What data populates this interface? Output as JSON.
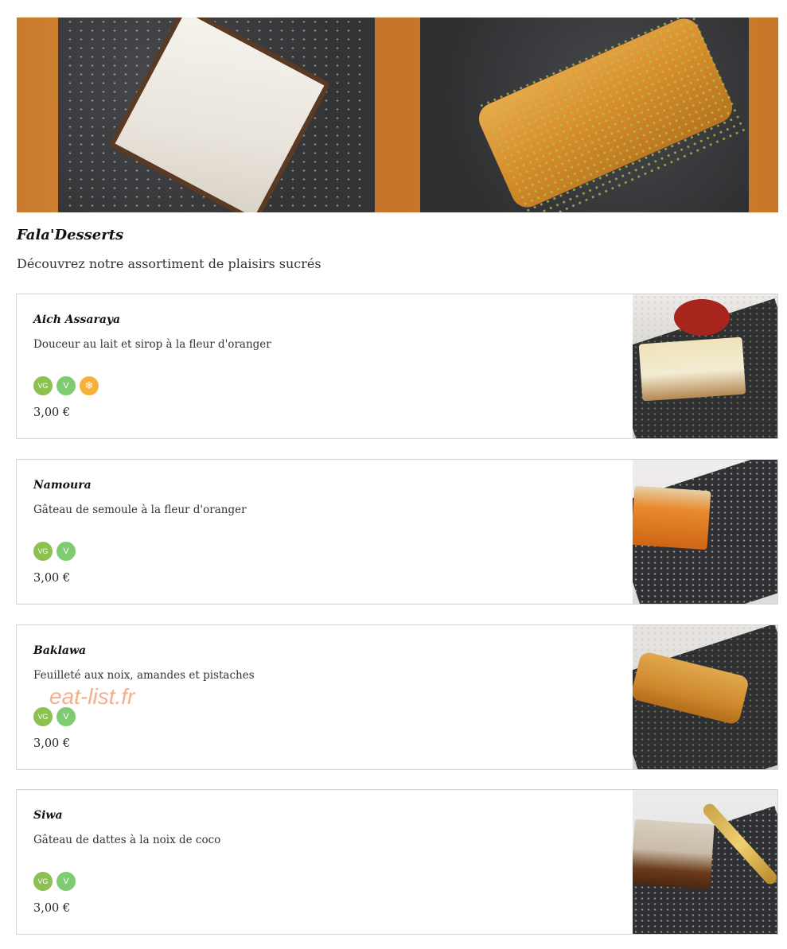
{
  "section": {
    "title": "Fala'Desserts",
    "subtitle": "Découvrez notre assortiment de plaisirs sucrés"
  },
  "items": [
    {
      "name": "Aich Assaraya",
      "description": "Douceur au lait et sirop à la fleur d'oranger",
      "badges": [
        "VG",
        "V",
        "gluten-free"
      ],
      "price": "3,00 €"
    },
    {
      "name": "Namoura",
      "description": "Gâteau de semoule à la fleur d'oranger",
      "badges": [
        "VG",
        "V"
      ],
      "price": "3,00 €"
    },
    {
      "name": "Baklawa",
      "description": "Feuilleté aux noix, amandes et pistaches",
      "badges": [
        "VG",
        "V"
      ],
      "price": "3,00 €"
    },
    {
      "name": "Siwa",
      "description": "Gâteau de dattes à la noix de coco",
      "badges": [
        "VG",
        "V"
      ],
      "price": "3,00 €"
    }
  ],
  "badge_labels": {
    "vg": "VG",
    "v": "V"
  },
  "watermark": "eat-list.fr",
  "colors": {
    "badge_vg": "#8cc152",
    "badge_v": "#7ecb72",
    "badge_gluten_free": "#f5b13c",
    "card_border": "#d4d4d4"
  }
}
